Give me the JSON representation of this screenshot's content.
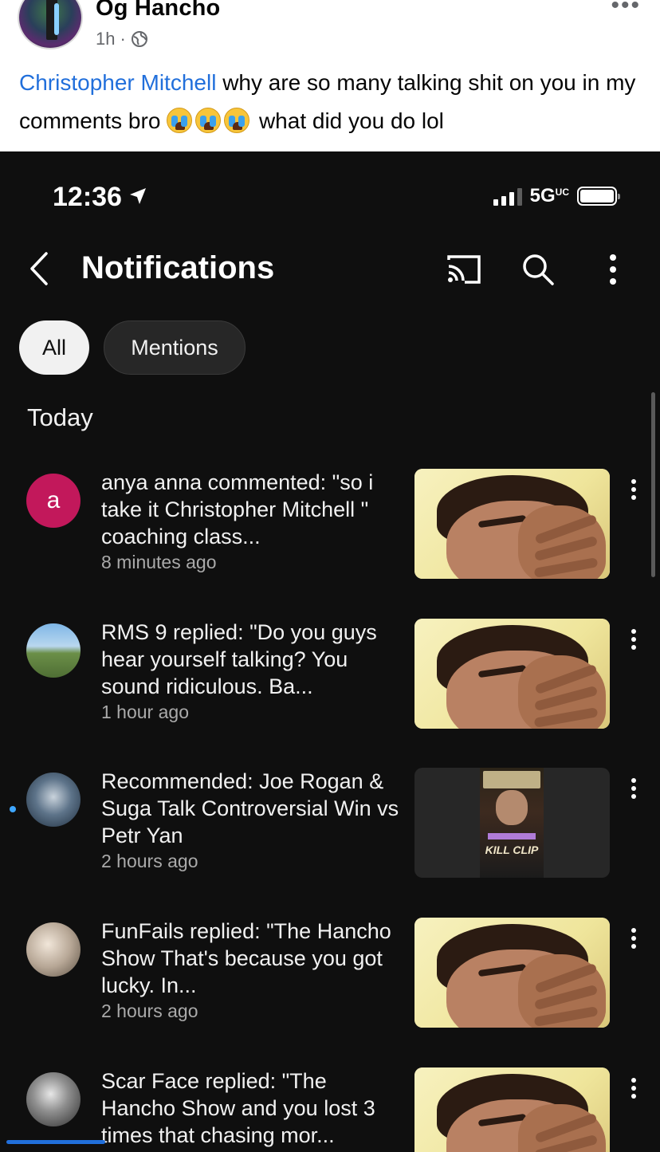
{
  "post": {
    "author": "Og Hancho",
    "time": "1h",
    "separator": "·",
    "mention": "Christopher Mitchell",
    "text_part1": " why are so many talking shit on you in my comments bro ",
    "text_part2": " what did you do lol",
    "emojis": [
      "crying-face",
      "crying-face",
      "crying-face"
    ]
  },
  "status_bar": {
    "time": "12:36",
    "network": "5G",
    "network_sub": "UC"
  },
  "app_bar": {
    "title": "Notifications"
  },
  "chips": [
    {
      "label": "All",
      "selected": true
    },
    {
      "label": "Mentions",
      "selected": false
    }
  ],
  "section": {
    "title": "Today"
  },
  "notifications": [
    {
      "avatar_letter": "a",
      "message": "anya anna commented: \"so i take it Christopher Mitchell \" coaching class...",
      "ago": "8 minutes ago",
      "thumbnail": "face-palm",
      "unread": false
    },
    {
      "avatar_letter": "",
      "message": "RMS 9 replied: \"Do you guys hear yourself talking? You sound ridiculous. Ba...",
      "ago": "1 hour ago",
      "thumbnail": "face-palm",
      "unread": false
    },
    {
      "avatar_letter": "",
      "message": "Recommended: Joe Rogan & Suga Talk Controversial Win vs Petr Yan",
      "ago": "2 hours ago",
      "thumbnail": "video-clip",
      "thumbnail_label": "KILL CLIP",
      "unread": true
    },
    {
      "avatar_letter": "",
      "message": "FunFails replied: \"The Hancho Show That's because you got lucky. In...",
      "ago": "2 hours ago",
      "thumbnail": "face-palm",
      "unread": false
    },
    {
      "avatar_letter": "",
      "message": "Scar Face replied: \"The Hancho Show and you lost 3 times that chasing mor...",
      "ago": "",
      "thumbnail": "face-palm",
      "unread": false
    }
  ],
  "colors": {
    "mention_link": "#216fdb",
    "phone_bg": "#0f0f0f",
    "chip_selected_bg": "#f1f1f1",
    "chip_bg": "#272727",
    "letter_avatar_bg": "#c2185b",
    "unread_dot": "#3ea6ff"
  },
  "icons": {
    "back": "chevron-left-icon",
    "cast": "cast-icon",
    "search": "search-icon",
    "more": "more-vert-icon",
    "location": "location-arrow-icon",
    "privacy": "globe-icon"
  }
}
